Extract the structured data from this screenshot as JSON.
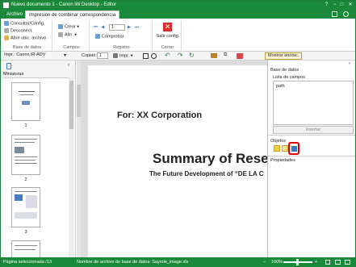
{
  "window": {
    "title": "Nuevo documento 1 - Canon iW Desktop - Editor",
    "controls": [
      "?",
      "−",
      "□",
      "✕"
    ]
  },
  "tabs": [
    {
      "label": "Archivo"
    },
    {
      "label": "Impresión de combinar correspondencia"
    }
  ],
  "ribbon": {
    "groups": [
      {
        "name": "Base de datos",
        "items": [
          "Consultar/Config.",
          "Desconect.",
          "Abrir ubic. archivo"
        ]
      },
      {
        "name": "Campos",
        "items": [
          "Crear",
          "Alin."
        ]
      },
      {
        "name": "Registro",
        "items": [
          "1",
          "Comprobar"
        ]
      },
      {
        "name": "Cerrar",
        "items": [
          "Salir config."
        ]
      }
    ]
  },
  "toolbar": {
    "printer_label": "Impr.:",
    "printer_value": "Canon iR-ADV",
    "copies_label": "Copias:",
    "copies_value": "1",
    "print_button": "Impr.",
    "show_annotations": "Mostrar anotac."
  },
  "left_panel": {
    "title": "Miniaturas",
    "pages": [
      "1",
      "2",
      "3"
    ]
  },
  "document": {
    "for_line": "For: XX Corporation",
    "title": "Summary of Rese",
    "subtitle": "The Future Development of “DE LA C"
  },
  "right_panel": {
    "database_title": "Base de datos",
    "field_list_title": "Lista de campos",
    "field_item": "path",
    "insert_button": "Insertar",
    "objects_title": "Objetos",
    "properties_title": "Propiedades"
  },
  "status": {
    "page": "Página seleccionada /13",
    "file": "Nombre de archivo de base de datos: Sayrole_image.xls",
    "zoom": "100%"
  },
  "colors": {
    "brand": "#1a8a3a",
    "highlight": "#e00000"
  }
}
